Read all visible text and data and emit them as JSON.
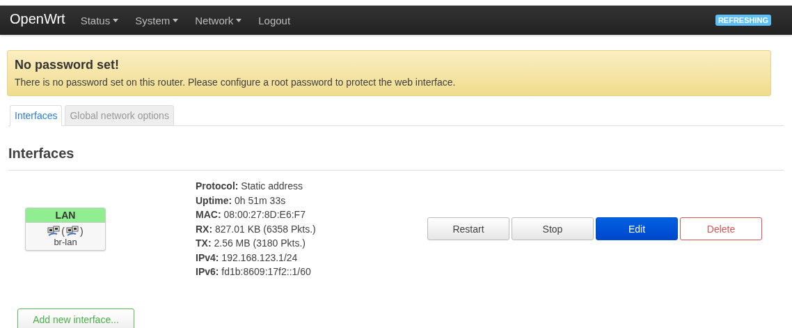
{
  "header": {
    "brand": "OpenWrt",
    "menu": [
      {
        "label": "Status",
        "dropdown": true
      },
      {
        "label": "System",
        "dropdown": true
      },
      {
        "label": "Network",
        "dropdown": true
      },
      {
        "label": "Logout",
        "dropdown": false
      }
    ],
    "badge": "REFRESHING"
  },
  "alert": {
    "title": "No password set!",
    "message": "There is no password set on this router. Please configure a root password to protect the web interface."
  },
  "tabs": [
    {
      "label": "Interfaces",
      "selected": true
    },
    {
      "label": "Global network options",
      "selected": false
    }
  ],
  "section_title": "Interfaces",
  "interfaces": [
    {
      "name": "LAN",
      "color": "#90ee90",
      "paren_open": "(",
      "paren_close": ")",
      "device": "br-lan",
      "details": [
        "**Protocol:** Static address",
        "**Uptime:** 0h 51m 33s",
        "**MAC:** 08:00:27:8D:E6:F7",
        "**RX:** 827.01 KB (6358 Pkts.)",
        "**TX:** 2.56 MB (3180 Pkts.)",
        "**IPv4:** 192.168.123.1/24",
        "**IPv6:** fd1b:8609:17f2::1/60"
      ],
      "buttons": [
        {
          "label": "Restart",
          "kind": "default"
        },
        {
          "label": "Stop",
          "kind": "default"
        },
        {
          "label": "Edit",
          "kind": "primary"
        },
        {
          "label": "Delete",
          "kind": "negative"
        }
      ]
    }
  ],
  "add_button": "Add new interface..."
}
